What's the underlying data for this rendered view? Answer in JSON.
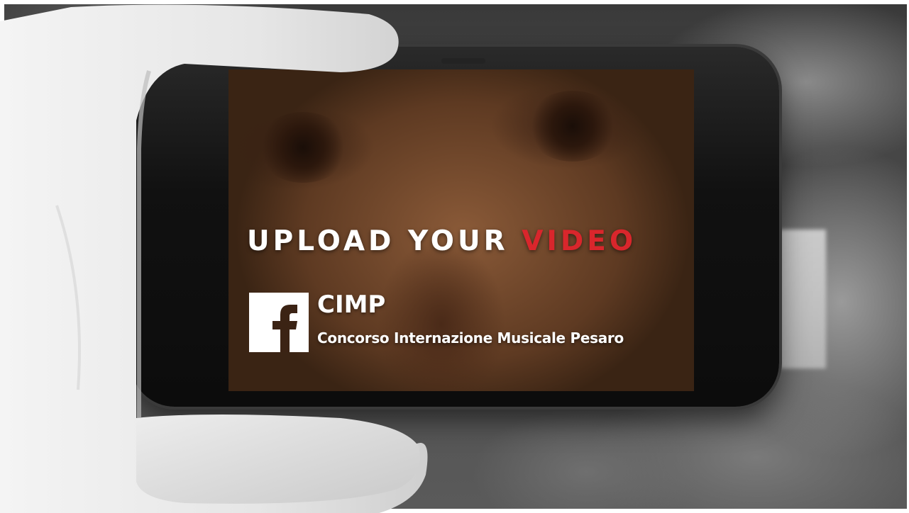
{
  "headline": {
    "primary": "UPLOAD YOUR ",
    "accent": "VIDEO",
    "accent_color": "#d9262c"
  },
  "brand": {
    "icon": "facebook-icon",
    "name": "CIMP",
    "full_name": "Concorso Internazione Musicale Pesaro"
  },
  "colors": {
    "text": "#ffffff",
    "phone_body": "#111111"
  }
}
